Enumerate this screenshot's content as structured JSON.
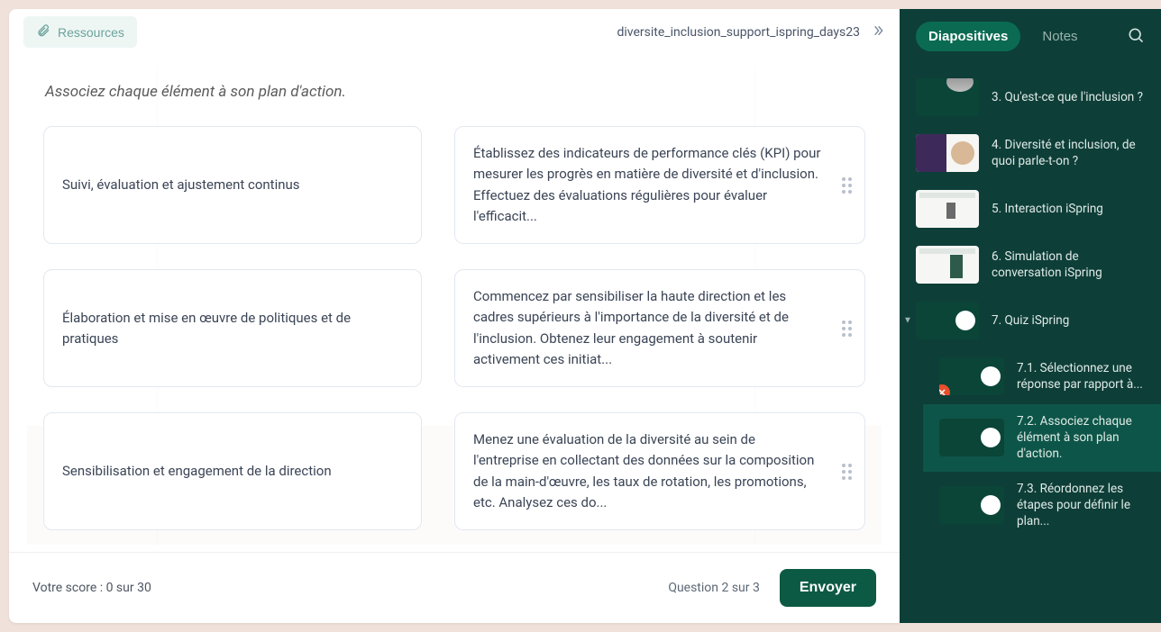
{
  "topbar": {
    "resources_label": "Ressources",
    "presentation_title": "diversite_inclusion_support_ispring_days23"
  },
  "quiz": {
    "instruction": "Associez chaque élément à son plan d'action.",
    "left": [
      "Suivi, évaluation et ajustement continus",
      "Élaboration et mise en œuvre de politiques et de pratiques",
      "Sensibilisation et engagement de la direction"
    ],
    "right": [
      "Établissez des indicateurs de performance clés (KPI) pour mesurer les progrès en matière de diversité et d'inclusion. Effectuez des évaluations régulières pour évaluer l'efficacit...",
      "Commencez par sensibiliser la haute direction et les cadres supérieurs à l'importance de la diversité et de l'inclusion. Obtenez leur engagement à soutenir activement ces initiat...",
      "Menez une évaluation de la diversité au sein de l'entreprise en collectant des données sur la composition de la main-d'œuvre, les taux de rotation, les promotions, etc. Analysez ces do..."
    ]
  },
  "footer": {
    "score_label": "Votre score : 0 sur 30",
    "progress_label": "Question 2 sur 3",
    "submit_label": "Envoyer"
  },
  "sidebar": {
    "tab_slides": "Diapositives",
    "tab_notes": "Notes",
    "slides": [
      {
        "label": "3. Qu'est-ce que l'inclusion ?"
      },
      {
        "label": "4. Diversité et inclusion, de quoi parle-t-on ?"
      },
      {
        "label": "5. Interaction iSpring"
      },
      {
        "label": "6. Simulation de conversation iSpring"
      },
      {
        "label": "7. Quiz iSpring"
      }
    ],
    "subslides": [
      {
        "label": "7.1. Sélectionnez une réponse par rapport à..."
      },
      {
        "label": "7.2. Associez chaque élément à son plan d'action."
      },
      {
        "label": "7.3. Réordonnez les étapes pour définir le plan..."
      }
    ]
  }
}
